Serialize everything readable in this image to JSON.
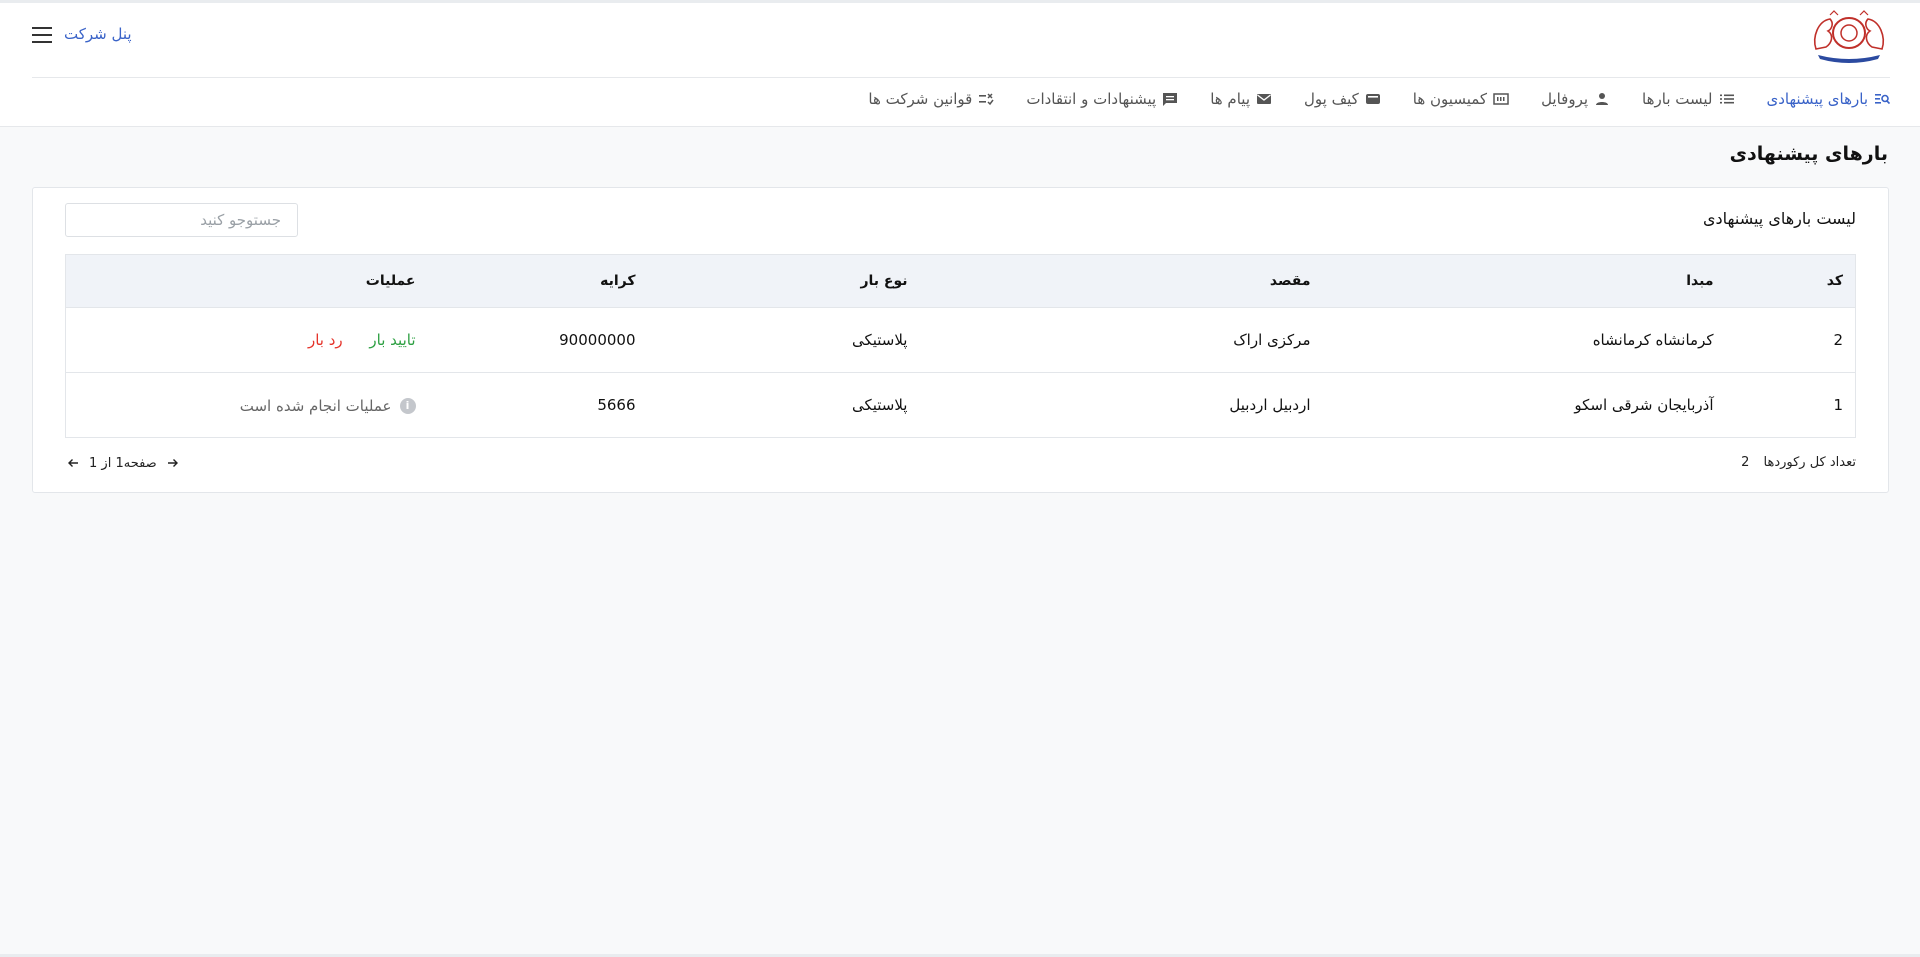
{
  "header": {
    "panel_label": "پنل شرکت"
  },
  "nav": {
    "items": [
      {
        "label": "بارهای پیشنهادی",
        "icon": "search-list-icon",
        "active": true
      },
      {
        "label": "لیست بارها",
        "icon": "list-icon"
      },
      {
        "label": "پروفایل",
        "icon": "person-icon"
      },
      {
        "label": "کمیسیون ها",
        "icon": "commission-icon"
      },
      {
        "label": "کیف پول",
        "icon": "wallet-icon"
      },
      {
        "label": "پیام ها",
        "icon": "mail-icon"
      },
      {
        "label": "پیشنهادات و انتقادات",
        "icon": "comment-icon"
      },
      {
        "label": "قوانین شرکت ها",
        "icon": "rules-checklist-icon"
      }
    ]
  },
  "page": {
    "title": "بارهای پیشنهادی"
  },
  "card": {
    "title": "لیست بارهای پیشنهادی",
    "search_placeholder": "جستوجو کنید"
  },
  "table": {
    "headers": {
      "code": "کد",
      "origin": "مبدا",
      "destination": "مقصد",
      "load_type": "نوع بار",
      "fare": "کرایه",
      "operations": "عملیات"
    },
    "rows": [
      {
        "code": "2",
        "origin": "کرمانشاه کرمانشاه",
        "destination": "مرکزی اراک",
        "load_type": "پلاستیکی",
        "fare": "90000000",
        "approve_label": "تایید بار",
        "reject_label": "رد بار"
      },
      {
        "code": "1",
        "origin": "آذربایجان شرقی اسکو",
        "destination": "اردبیل اردبیل",
        "load_type": "پلاستیکی",
        "fare": "5666",
        "done_label": "عملیات انجام شده است"
      }
    ]
  },
  "footer": {
    "total_label": "تعداد کل رکوردها",
    "total_count": "2",
    "page_label": "صفحه1 از 1"
  },
  "colors": {
    "accent": "#3a63c8",
    "approve": "#2ea043",
    "reject": "#e5342b"
  }
}
